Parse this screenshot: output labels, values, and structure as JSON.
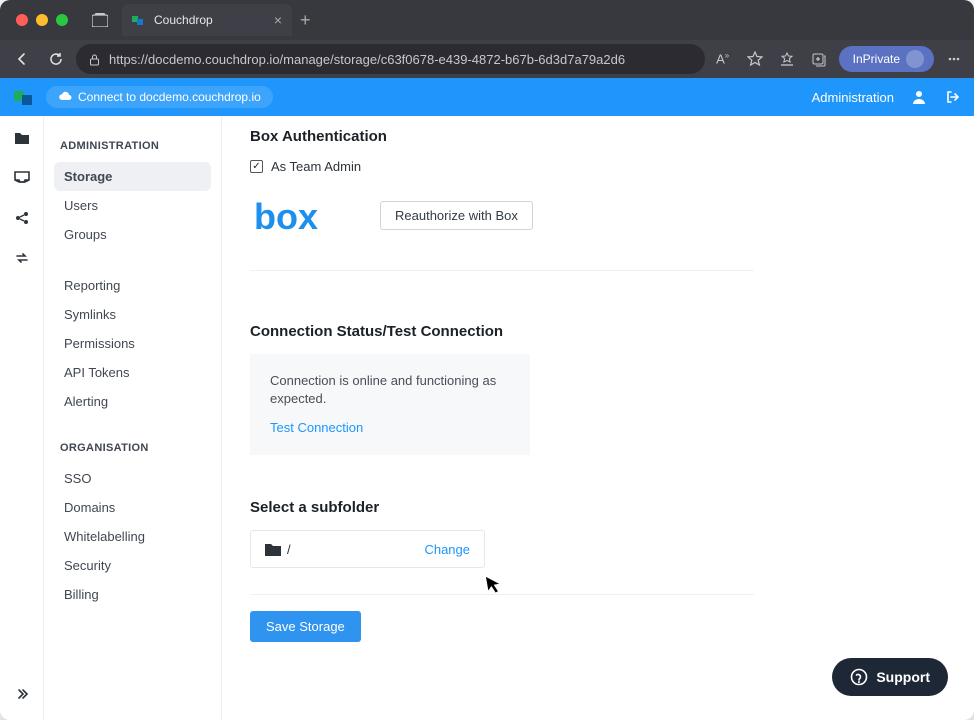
{
  "browser": {
    "tab_title": "Couchdrop",
    "url_display": "https://docdemo.couchdrop.io/manage/storage/c63f0678-e439-4872-b67b-6d3d7a79a2d6",
    "url_host": "docdemo.couchdrop.io",
    "private_label": "InPrivate"
  },
  "appbar": {
    "connect_label": "Connect to docdemo.couchdrop.io",
    "admin_link": "Administration"
  },
  "sidebar": {
    "section1": "ADMINISTRATION",
    "section2": "ORGANISATION",
    "items1": [
      "Storage",
      "Users",
      "Groups"
    ],
    "items2": [
      "Reporting",
      "Symlinks",
      "Permissions",
      "API Tokens",
      "Alerting"
    ],
    "items3": [
      "SSO",
      "Domains",
      "Whitelabelling",
      "Security",
      "Billing"
    ]
  },
  "content": {
    "auth_title": "Box Authentication",
    "team_admin_label": "As Team Admin",
    "team_admin_checked": true,
    "reauth_btn": "Reauthorize with Box",
    "status_title": "Connection Status/Test Connection",
    "status_text": "Connection is online and functioning as expected.",
    "test_link": "Test Connection",
    "subfolder_title": "Select a subfolder",
    "subfolder_path": "/",
    "change_label": "Change",
    "save_btn": "Save Storage"
  },
  "support_label": "Support",
  "colors": {
    "accent": "#1e96fc"
  }
}
